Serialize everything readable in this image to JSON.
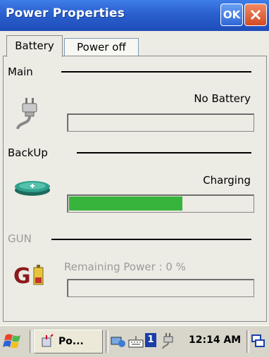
{
  "window": {
    "title": "Power Properties",
    "ok_label": "OK"
  },
  "tabs": [
    {
      "label": "Battery",
      "active": true
    },
    {
      "label": "Power off",
      "active": false
    }
  ],
  "sections": {
    "main": {
      "label": "Main",
      "status": "No Battery",
      "level": 0
    },
    "backup": {
      "label": "BackUp",
      "status": "Charging",
      "level": 0.62
    },
    "gun": {
      "label": "GUN",
      "status": "Remaining Power : 0 %",
      "level": 0
    }
  },
  "taskbar": {
    "task_label": "Po...",
    "clock": "12:14 AM",
    "input_indicator": "1"
  },
  "colors": {
    "title_blue": "#2a5fcf",
    "progress_green": "#37b43c",
    "disabled_gray": "#9b9b9b"
  },
  "icons": [
    "plug-icon",
    "battery-disc-icon",
    "gun-battery-icon",
    "windows-flag-icon",
    "keyboard-icon",
    "network-icon",
    "desktop-icon"
  ]
}
